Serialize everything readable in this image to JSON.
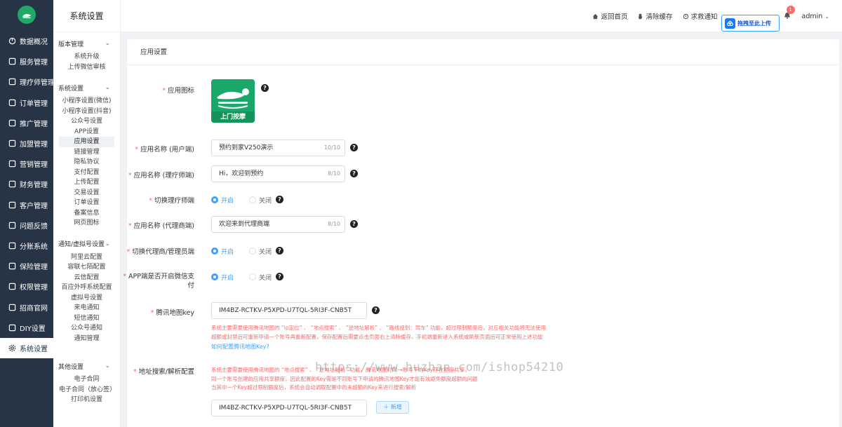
{
  "sidebar": {
    "items": [
      {
        "label": "数据概况",
        "icon": "dashboard-icon"
      },
      {
        "label": "服务管理",
        "icon": "service-icon"
      },
      {
        "label": "理疗师管理",
        "icon": "therapist-icon"
      },
      {
        "label": "订单管理",
        "icon": "order-icon"
      },
      {
        "label": "推广管理",
        "icon": "promote-icon"
      },
      {
        "label": "加盟管理",
        "icon": "franchise-icon"
      },
      {
        "label": "营销管理",
        "icon": "marketing-icon"
      },
      {
        "label": "财务管理",
        "icon": "finance-icon"
      },
      {
        "label": "客户管理",
        "icon": "customer-icon"
      },
      {
        "label": "问题反馈",
        "icon": "feedback-icon"
      },
      {
        "label": "分账系统",
        "icon": "split-icon"
      },
      {
        "label": "保险管理",
        "icon": "insurance-icon"
      },
      {
        "label": "权限管理",
        "icon": "permission-icon"
      },
      {
        "label": "招商官网",
        "icon": "website-icon"
      },
      {
        "label": "DIY设置",
        "icon": "diy-icon"
      },
      {
        "label": "系统设置",
        "icon": "gear-icon"
      }
    ]
  },
  "submenu": {
    "title": "系统设置",
    "groups": [
      {
        "title": "版本管理",
        "items": [
          "系统升级",
          "上传微信审核"
        ]
      },
      {
        "title": "系统设置",
        "items": [
          "小程序设置(微信)",
          "小程序设置(抖音)",
          "公众号设置",
          "APP设置",
          "应用设置",
          "链接管理",
          "隐私协议",
          "支付配置",
          "上传配置",
          "交易设置",
          "订单设置",
          "备案信息",
          "网页图标"
        ]
      },
      {
        "title": "通知/虚拟号设置",
        "items": [
          "阿里云配置",
          "容联七陌配置",
          "云信配置",
          "百应外呼系统配置",
          "虚拟号设置",
          "来电通知",
          "短信通知",
          "公众号通知",
          "通知管理"
        ]
      },
      {
        "title": "其他设置",
        "items": [
          "电子合同",
          "电子合同（放心签）",
          "打印机设置"
        ]
      }
    ]
  },
  "header": {
    "links": [
      {
        "label": "返回首页",
        "icon": "home-icon"
      },
      {
        "label": "清除缓存",
        "icon": "brush-icon"
      },
      {
        "label": "求救通知",
        "icon": "alarm-icon"
      }
    ],
    "badge_count": "1",
    "user": "admin",
    "upload_label": "拖拽至此上传"
  },
  "card": {
    "title": "应用设置",
    "app_icon": {
      "label": "应用图标",
      "caption": "上门按摩"
    },
    "app_name_user": {
      "label": "应用名称 (用户端)",
      "value": "预约到家V250演示",
      "count": "10/10"
    },
    "app_name_therapist": {
      "label": "应用名称 (理疗师端)",
      "value": "Hi，欢迎到预约",
      "count": "8/10"
    },
    "switch_therapist": {
      "label": "切换理疗师端",
      "on": "开启",
      "off": "关闭"
    },
    "app_name_agent": {
      "label": "应用名称 (代理商端)",
      "value": "欢迎来到代理商端",
      "count": "8/10"
    },
    "switch_agent": {
      "label": "切换代理商/管理员端",
      "on": "开启",
      "off": "关闭"
    },
    "app_wechat_pay": {
      "label": "APP端是否开启微信支付",
      "on": "开启",
      "off": "关闭"
    },
    "tencent_map": {
      "label": "腾讯地图key",
      "value": "IM4BZ-RCTKV-P5XPD-U7TQL-5RI3F-CNB5T",
      "note1": "系统主要需要使用腾讯地图的 “ip定位” 、 “地点搜索” 、 “逆地址解析” 、 “路线规划：驾车” 功能，超过限制额度后，对应相关功能将无法使用",
      "note2": "超额或封禁后可重新申请一个账号再重新配置，保存配置后需要点击页面右上清除缓存，手机端重新进入系统或刷新页面后可正常使用上述功能",
      "link": "如何配置腾讯地图Key?"
    },
    "address_search": {
      "label": "地址搜索/解析配置",
      "note1": "系统主要需要使用腾讯地图的 “地点搜索” 、 “逆地址解析” 功能，腾讯地图对同一账号下的Key存在额度共享，",
      "note2": "同一个账号创建的应用共享额度，因此配置的Key需是不同账号下申请的腾讯地图Key才能有效避免额度超额的问题",
      "note3": "当其中一个Key超过限制额度后，系统会自动调取配置中的未超额的Key来进行搜索/解析",
      "value": "IM4BZ-RCTKV-P5XPD-U7TQL-5RI3F-CNB5T",
      "add_label": "＋ 新增"
    }
  },
  "watermark": "https://www.huzhan.com/ishop54210"
}
